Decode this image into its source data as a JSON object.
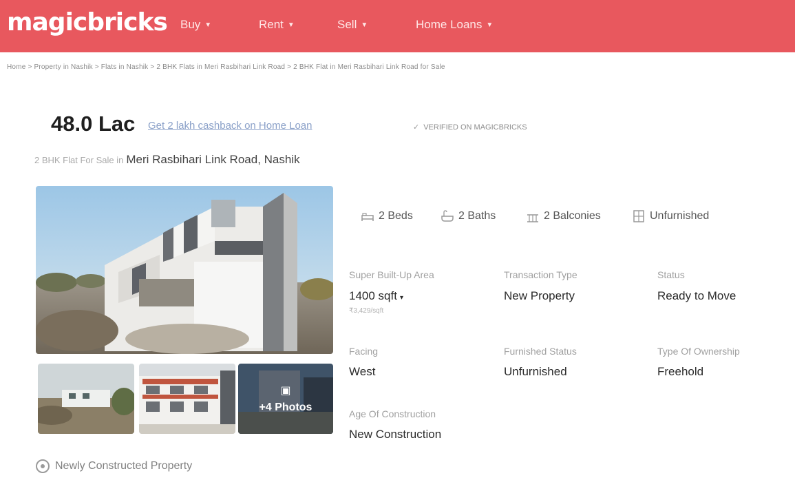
{
  "header": {
    "logo": "magicbricks",
    "nav": [
      {
        "label": "Buy"
      },
      {
        "label": "Rent"
      },
      {
        "label": "Sell"
      },
      {
        "label": "Home Loans"
      }
    ]
  },
  "breadcrumb": "Home > Property in Nashik > Flats in Nashik > 2 BHK Flats in Meri Rasbihari Link Road > 2 BHK Flat in Meri Rasbihari Link Road for Sale",
  "listing": {
    "price": "48.0 Lac",
    "cashback_link": "Get 2 lakh cashback on Home Loan",
    "verified": "VERIFIED ON MAGICBRICKS",
    "subtitle_prefix": "2 BHK Flat For Sale in",
    "location": "Meri Rasbihari Link Road, Nashik",
    "photos_more": "+4 Photos"
  },
  "amenities": [
    {
      "icon": "bed-icon",
      "label": "2 Beds"
    },
    {
      "icon": "bath-icon",
      "label": "2 Baths"
    },
    {
      "icon": "balcony-icon",
      "label": "2 Balconies"
    },
    {
      "icon": "wardrobe-icon",
      "label": "Unfurnished"
    }
  ],
  "summary": {
    "area_label": "Super Built-Up Area",
    "area_value": "1400 sqft",
    "area_sub": "₹3,429/sqft",
    "transaction_label": "Transaction Type",
    "transaction_value": "New Property",
    "status_label": "Status",
    "status_value": "Ready to Move",
    "facing_label": "Facing",
    "facing_value": "West",
    "furnished_label": "Furnished Status",
    "furnished_value": "Unfurnished",
    "ownership_label": "Type Of Ownership",
    "ownership_value": "Freehold",
    "age_label": "Age Of Construction",
    "age_value": "New Construction"
  },
  "badge": "Newly Constructed Property",
  "colors": {
    "header_bg": "#e8585e",
    "link": "#8aa0c8"
  }
}
